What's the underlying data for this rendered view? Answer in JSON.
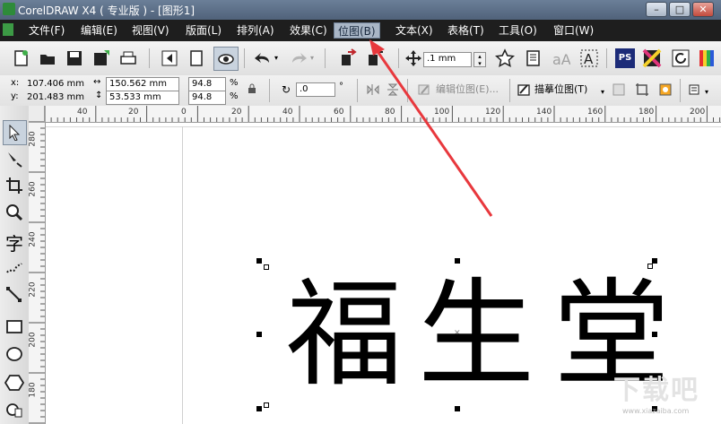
{
  "window": {
    "title": "CorelDRAW X4 ( 专业版 ) - [图形1]"
  },
  "menubar": {
    "items": [
      "文件(F)",
      "编辑(E)",
      "视图(V)",
      "版面(L)",
      "排列(A)",
      "效果(C)",
      "位图(B)",
      "文本(X)",
      "表格(T)",
      "工具(O)",
      "窗口(W)"
    ],
    "active": "位图(B)"
  },
  "toolbar": {
    "nudge_value": ".1 mm",
    "ps_label": "PS"
  },
  "propbar": {
    "x_label": "x:",
    "x_value": "107.406 mm",
    "y_label": "y:",
    "y_value": "201.483 mm",
    "width_value": "150.562 mm",
    "height_value": "53.533 mm",
    "scale_x": "94.8",
    "scale_y": "94.8",
    "percent": "%",
    "rotation_value": ".0",
    "degree": "°",
    "edit_bitmap": "编辑位图(E)...",
    "trace_bitmap": "描摹位图(T)"
  },
  "rulers": {
    "h_labels": [
      "40",
      "20",
      "0",
      "20",
      "40",
      "60",
      "80",
      "100",
      "120",
      "140",
      "160",
      "180",
      "200"
    ],
    "v_labels": [
      "280",
      "260",
      "240",
      "220",
      "200",
      "180"
    ]
  },
  "toolbox": {
    "text_tool": "字"
  },
  "document": {
    "characters": [
      "福",
      "生",
      "堂"
    ]
  },
  "watermark": {
    "text": "下载吧",
    "url": "www.xiazaiba.com"
  },
  "colors": {
    "menubar": "#1e1e1e",
    "active_menu": "#a9b6c6",
    "annotation_arrow": "#e8383d"
  }
}
